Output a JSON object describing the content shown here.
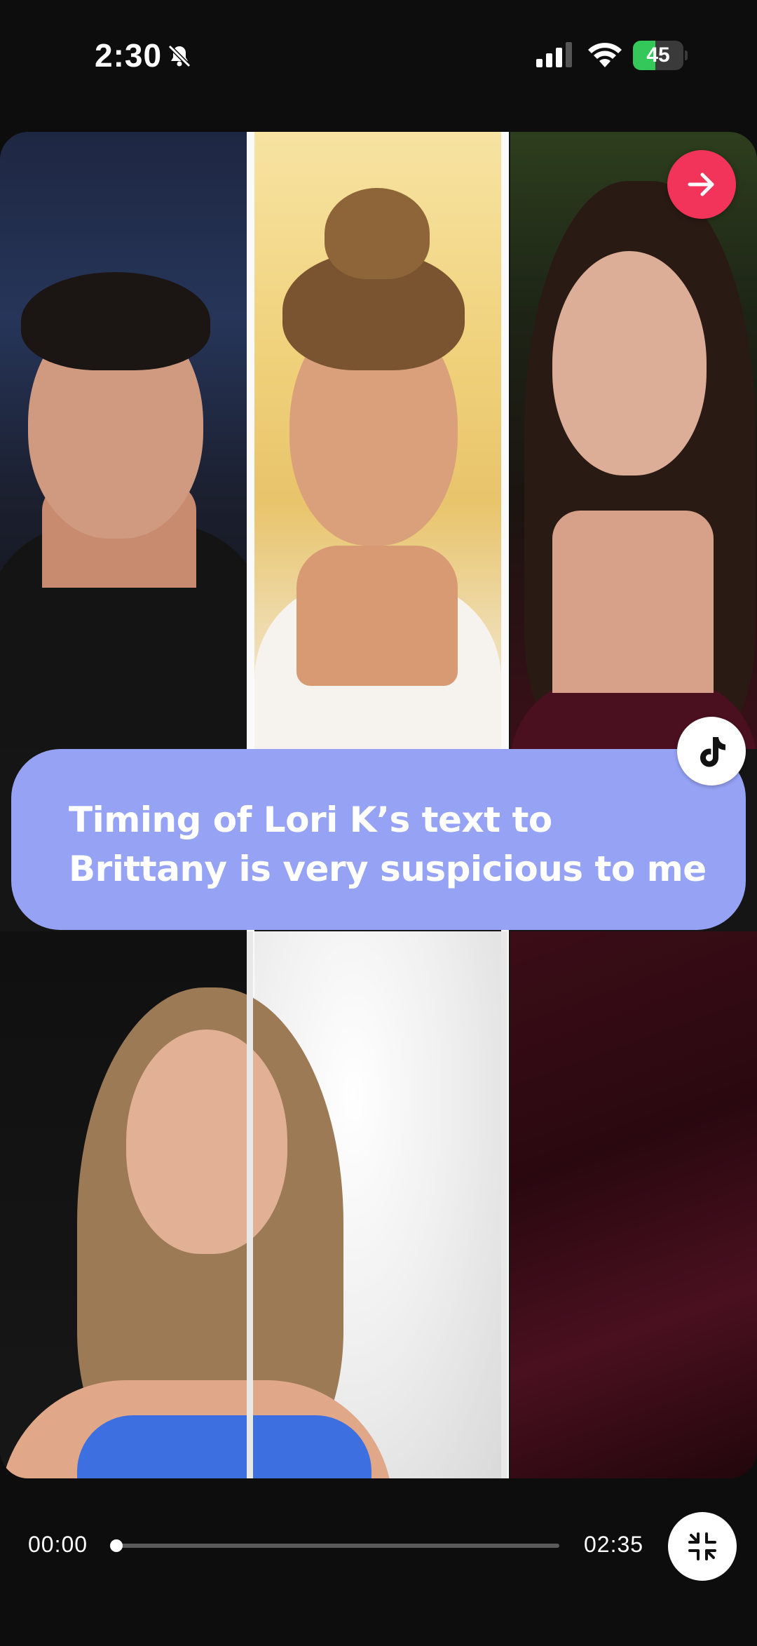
{
  "status_bar": {
    "time": "2:30",
    "battery_percent": 45,
    "battery_label": "45",
    "icons": [
      "bell-off-icon",
      "cellular-signal-icon",
      "wifi-icon",
      "battery-charging-icon"
    ]
  },
  "media": {
    "caption": "Timing of Lori K’s text to Brittany is very suspicious to me",
    "caption_color": "#96a3f5",
    "next_button_color": "#f2345a",
    "next_icon": "arrow-right-icon",
    "source_badge_icon": "tiktok-logo-icon"
  },
  "player": {
    "current_time": "00:00",
    "total_time": "02:35",
    "progress_fraction": 0.0,
    "collapse_icon": "collapse-icon"
  }
}
